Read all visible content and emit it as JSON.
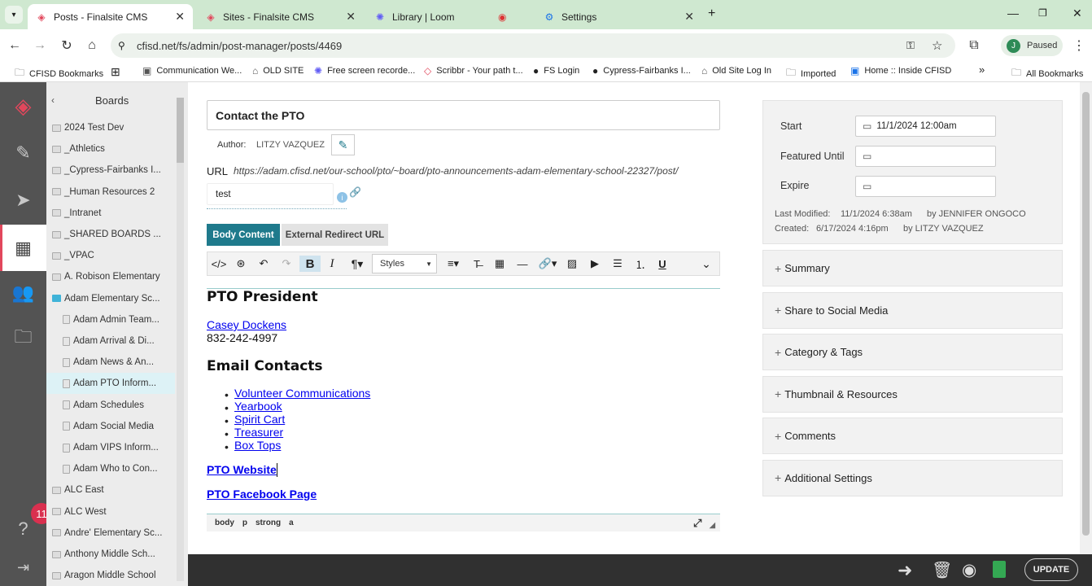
{
  "tabs": [
    {
      "title": "Posts - Finalsite CMS",
      "icon": "finalsite-logo-icon",
      "active": true
    },
    {
      "title": "Sites - Finalsite CMS",
      "icon": "finalsite-logo-icon",
      "active": false
    },
    {
      "title": "Library | Loom",
      "icon": "loom-icon",
      "active": false
    },
    {
      "title": "Settings",
      "icon": "gear-icon",
      "active": false
    }
  ],
  "address": {
    "url": "cfisd.net/fs/admin/post-manager/posts/4469",
    "profile_initial": "J",
    "profile_status": "Paused"
  },
  "bookmarks": [
    {
      "label": "CFISD Bookmarks",
      "icon": "folder-icon"
    },
    {
      "label": "Communication We...",
      "icon": "page-icon"
    },
    {
      "label": "OLD SITE",
      "icon": "house-icon"
    },
    {
      "label": "Free screen recorde...",
      "icon": "loom-icon"
    },
    {
      "label": "Scribbr - Your path t...",
      "icon": "scribbr-icon"
    },
    {
      "label": "FS Login",
      "icon": "globe-icon"
    },
    {
      "label": "Cypress-Fairbanks I...",
      "icon": "globe-icon"
    },
    {
      "label": "Old Site Log In",
      "icon": "house-icon"
    },
    {
      "label": "Imported",
      "icon": "folder-icon"
    },
    {
      "label": "Home :: Inside CFISD",
      "icon": "page-icon"
    }
  ],
  "bookmarks_more": "»",
  "all_bookmarks": "All Bookmarks",
  "rail": {
    "badge": "11"
  },
  "boards": {
    "title": "Boards",
    "items": [
      {
        "label": "2024 Test Dev",
        "level": "top"
      },
      {
        "label": "_Athletics",
        "level": "top"
      },
      {
        "label": "_Cypress-Fairbanks I...",
        "level": "top"
      },
      {
        "label": "_Human Resources 2",
        "level": "top"
      },
      {
        "label": "_Intranet",
        "level": "top"
      },
      {
        "label": "_SHARED BOARDS ...",
        "level": "top"
      },
      {
        "label": "_VPAC",
        "level": "top"
      },
      {
        "label": "A. Robison Elementary",
        "level": "top"
      },
      {
        "label": "Adam Elementary Sc...",
        "level": "open"
      },
      {
        "label": "Adam Admin Team...",
        "level": "sub"
      },
      {
        "label": "Adam Arrival & Di...",
        "level": "sub"
      },
      {
        "label": "Adam News & An...",
        "level": "sub"
      },
      {
        "label": "Adam PTO Inform...",
        "level": "selected"
      },
      {
        "label": "Adam Schedules",
        "level": "sub"
      },
      {
        "label": "Adam Social Media",
        "level": "sub"
      },
      {
        "label": "Adam VIPS Inform...",
        "level": "sub"
      },
      {
        "label": "Adam Who to Con...",
        "level": "sub"
      },
      {
        "label": "ALC East",
        "level": "top"
      },
      {
        "label": "ALC West",
        "level": "top"
      },
      {
        "label": "Andre' Elementary Sc...",
        "level": "top"
      },
      {
        "label": "Anthony Middle Sch...",
        "level": "top"
      },
      {
        "label": "Aragon Middle School",
        "level": "top"
      }
    ]
  },
  "post": {
    "title": "Contact the PTO",
    "author_label": "Author:",
    "author": "LITZY VAZQUEZ",
    "url_label": "URL",
    "url": "https://adam.cfisd.net/our-school/pto/~board/pto-announcements-adam-elementary-school-22327/post/",
    "slug": "test",
    "tab_body": "Body Content",
    "tab_redirect": "External Redirect URL",
    "styles_label": "Styles"
  },
  "content": {
    "heading1": "PTO President",
    "president_name": "Casey Dockens",
    "president_phone": "832-242-4997",
    "heading2": "Email Contacts",
    "contacts": [
      "Volunteer Communications",
      "Yearbook",
      "Spirit Cart",
      "Treasurer",
      "Box Tops"
    ],
    "website": "PTO Website",
    "facebook": "PTO Facebook Page"
  },
  "statusbar": [
    "body",
    "p",
    "strong",
    "a"
  ],
  "schedule": {
    "start_label": "Start",
    "start_value": "11/1/2024 12:00am",
    "featured_label": "Featured Until",
    "featured_value": "",
    "expire_label": "Expire",
    "expire_value": "",
    "modified_label": "Last Modified:",
    "modified_value": "11/1/2024 6:38am",
    "modified_by": "by JENNIFER ONGOCO",
    "created_label": "Created:",
    "created_value": "6/17/2024 4:16pm",
    "created_by": "by LITZY VAZQUEZ"
  },
  "panels": [
    "Summary",
    "Share to Social Media",
    "Category & Tags",
    "Thumbnail & Resources",
    "Comments",
    "Additional Settings"
  ],
  "footer": {
    "update_label": "UPDATE"
  },
  "colors": {
    "accent": "#1f7a8c",
    "rail": "#535353",
    "brand": "#e2475c",
    "tabbar": "#cfe8d0"
  }
}
